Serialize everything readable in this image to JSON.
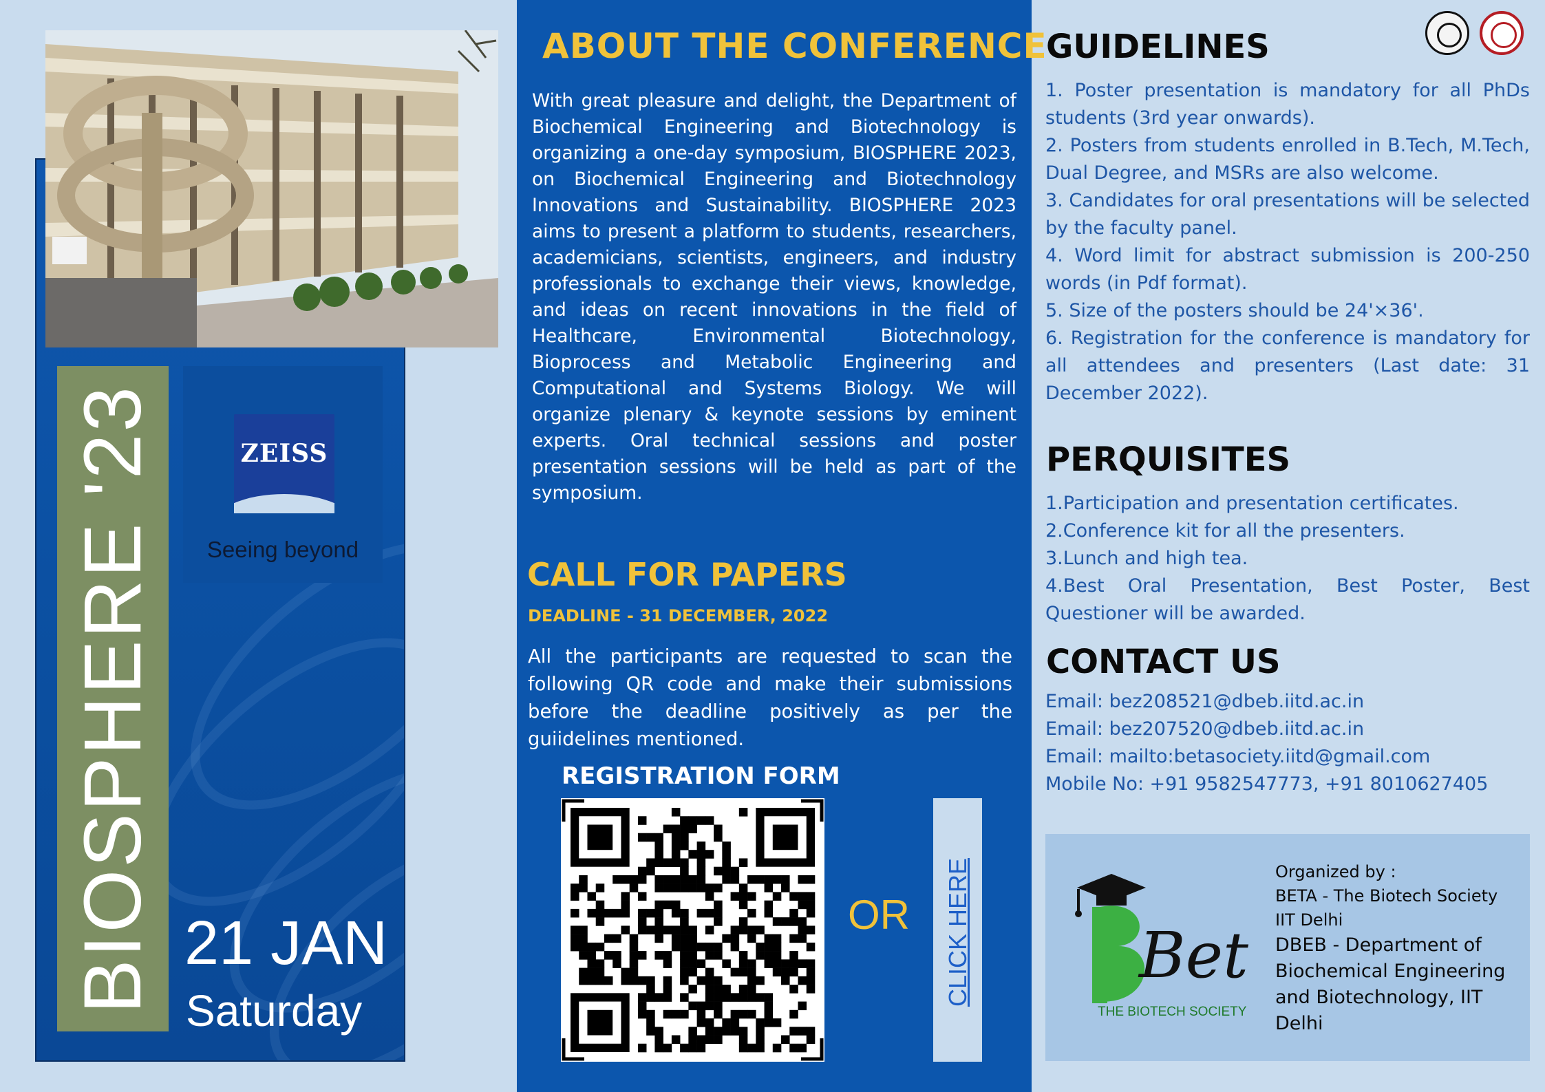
{
  "left_panel": {
    "vertical_title": "BIOSPHERE '23",
    "sponsor": {
      "logo_text": "ZEISS",
      "tagline": "Seeing beyond"
    },
    "date": "21 JAN",
    "day": "Saturday"
  },
  "about": {
    "heading": "ABOUT THE CONFERENCE",
    "body": "With great pleasure and delight, the Department of Biochemical Engineering and Biotechnology is organizing a one-day symposium, BIOSPHERE 2023, on Biochemical Engineering and Biotechnology Innovations and Sustainability. BIOSPHERE 2023 aims to present a platform to students, researchers, academicians, scientists, engineers, and industry professionals to exchange their views, knowledge, and ideas on recent innovations in the field of Healthcare, Environmental Biotechnology, Bioprocess and Metabolic Engineering and Computational and Systems Biology. We will organize plenary & keynote sessions by eminent experts. Oral technical sessions and poster presentation sessions will be held as part of the symposium."
  },
  "call_for_papers": {
    "heading": "CALL FOR PAPERS",
    "deadline": "DEADLINE - 31 DECEMBER, 2022",
    "body": "All the participants are requested to scan the following QR code and make their submissions before the deadline positively as per the guiidelines mentioned.",
    "registration_label": "REGISTRATION FORM",
    "or_label": "OR",
    "click_label": "CLICK HERE"
  },
  "guidelines": {
    "heading": "GUIDELINES",
    "items": [
      "1. Poster presentation is mandatory for all PhDs students (3rd year onwards).",
      "2. Posters from students enrolled in B.Tech, M.Tech, Dual Degree, and MSRs are also welcome.",
      "3. Candidates for oral presentations will be selected by the faculty panel.",
      "4. Word limit for abstract submission is 200-250 words (in Pdf format).",
      "5. Size of the posters should be 24'×36'.",
      "6. Registration for the conference is mandatory for all attendees and presenters (Last date: 31 December 2022)."
    ]
  },
  "perquisites": {
    "heading": "PERQUISITES",
    "items": [
      "1.Participation and presentation certificates.",
      "2.Conference kit for all the presenters.",
      "3.Lunch and high tea.",
      "4.Best Oral Presentation, Best Poster, Best Questioner will be awarded."
    ]
  },
  "contact": {
    "heading": "CONTACT US",
    "items": [
      "Email: bez208521@dbeb.iitd.ac.in",
      "Email: bez207520@dbeb.iitd.ac.in",
      "Email: mailto:betasociety.iitd@gmail.com",
      "Mobile No: +91 9582547773, +91 8010627405"
    ]
  },
  "organizer": {
    "logo_word": "Beta",
    "logo_subtitle": "THE BIOTECH SOCIETY",
    "label": "Organized by :",
    "line1": "BETA - The Biotech Society",
    "line2": "IIT Delhi",
    "line3": "DBEB - Department of Biochemical Engineering and Biotechnology, IIT Delhi"
  },
  "colors": {
    "panel_blue": "#0c56ad",
    "accent_yellow": "#f0c23a",
    "background": "#c9dcee",
    "sidebar_olive": "#7d8f63",
    "text_blue": "#1e56a6",
    "beta_green": "#3cb043"
  }
}
